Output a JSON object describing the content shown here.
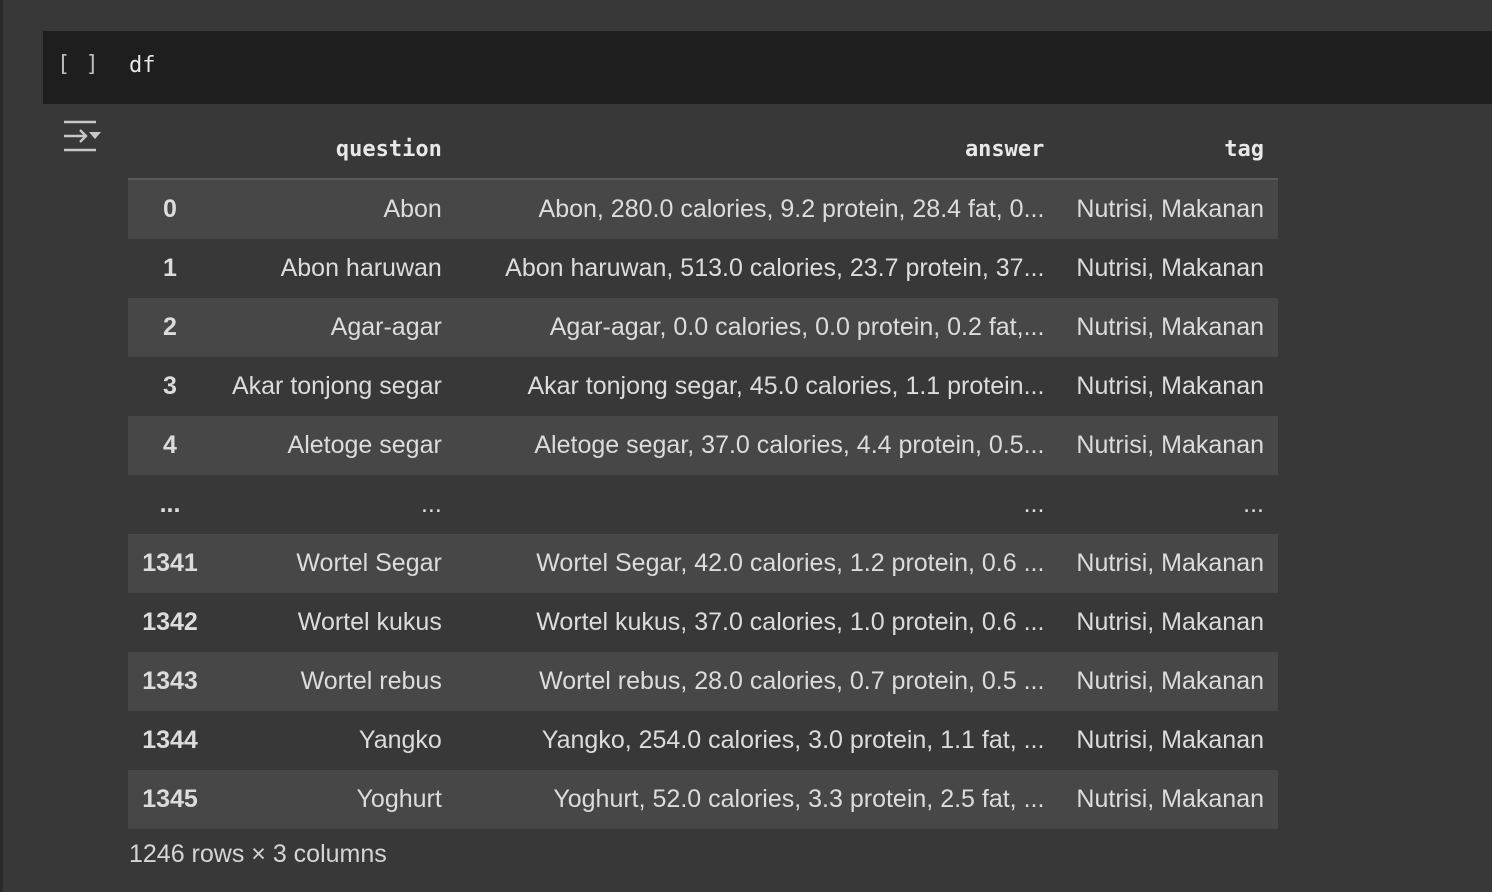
{
  "cell": {
    "run_brackets": "[ ]",
    "code": "df",
    "output_icon": "output-collapse-icon"
  },
  "table": {
    "columns": [
      "question",
      "answer",
      "tag"
    ],
    "rows": [
      {
        "index": "0",
        "question": "Abon",
        "answer": "Abon, 280.0 calories, 9.2 protein, 28.4 fat, 0...",
        "tag": "Nutrisi, Makanan"
      },
      {
        "index": "1",
        "question": "Abon haruwan",
        "answer": "Abon haruwan, 513.0 calories, 23.7 protein, 37...",
        "tag": "Nutrisi, Makanan"
      },
      {
        "index": "2",
        "question": "Agar-agar",
        "answer": "Agar-agar, 0.0 calories, 0.0 protein, 0.2 fat,...",
        "tag": "Nutrisi, Makanan"
      },
      {
        "index": "3",
        "question": "Akar tonjong segar",
        "answer": "Akar tonjong segar, 45.0 calories, 1.1 protein...",
        "tag": "Nutrisi, Makanan"
      },
      {
        "index": "4",
        "question": "Aletoge segar",
        "answer": "Aletoge segar, 37.0 calories, 4.4 protein, 0.5...",
        "tag": "Nutrisi, Makanan"
      },
      {
        "index": "...",
        "question": "...",
        "answer": "...",
        "tag": "..."
      },
      {
        "index": "1341",
        "question": "Wortel Segar",
        "answer": "Wortel Segar, 42.0 calories, 1.2 protein, 0.6 ...",
        "tag": "Nutrisi, Makanan"
      },
      {
        "index": "1342",
        "question": "Wortel kukus",
        "answer": "Wortel kukus, 37.0 calories, 1.0 protein, 0.6 ...",
        "tag": "Nutrisi, Makanan"
      },
      {
        "index": "1343",
        "question": "Wortel rebus",
        "answer": "Wortel rebus, 28.0 calories, 0.7 protein, 0.5 ...",
        "tag": "Nutrisi, Makanan"
      },
      {
        "index": "1344",
        "question": "Yangko",
        "answer": "Yangko, 254.0 calories, 3.0 protein, 1.1 fat, ...",
        "tag": "Nutrisi, Makanan"
      },
      {
        "index": "1345",
        "question": "Yoghurt",
        "answer": "Yoghurt, 52.0 calories, 3.3 protein, 2.5 fat, ...",
        "tag": "Nutrisi, Makanan"
      }
    ],
    "footer": "1246 rows × 3 columns"
  }
}
